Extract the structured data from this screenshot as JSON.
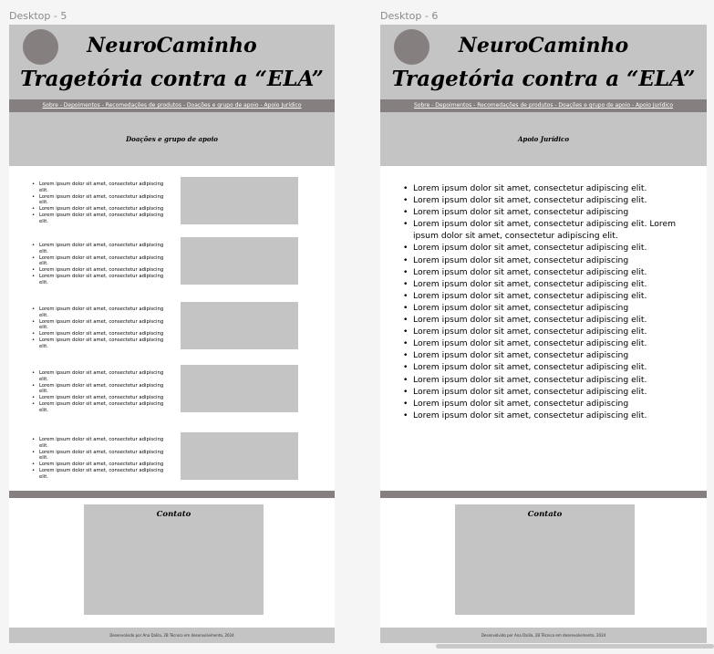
{
  "canvas": {
    "frames": [
      {
        "label": "Desktop - 5",
        "brand_line1": "NeuroCaminho",
        "brand_line2": "Tragetória contra a “ELA”",
        "nav": "Sobre - Depoimentos - Recomedações de produtos - Doações e grupo de apoio - Apoio Jurídico",
        "section_title": "Doações e grupo de apoio",
        "cards": [
          {
            "items": [
              "Lorem ipsum dolor sit amet, consectetur adipiscing elit.",
              "Lorem ipsum dolor sit amet, consectetur adipiscing elit.",
              "Lorem ipsum dolor sit amet, consectetur adipiscing",
              "Lorem ipsum dolor sit amet, consectetur adipiscing elit."
            ]
          },
          {
            "items": [
              "Lorem ipsum dolor sit amet, consectetur adipiscing elit.",
              "Lorem ipsum dolor sit amet, consectetur adipiscing elit.",
              "Lorem ipsum dolor sit amet, consectetur adipiscing",
              "Lorem ipsum dolor sit amet, consectetur adipiscing elit."
            ]
          },
          {
            "items": [
              "Lorem ipsum dolor sit amet, consectetur adipiscing elit.",
              "Lorem ipsum dolor sit amet, consectetur adipiscing elit.",
              "Lorem ipsum dolor sit amet, consectetur adipiscing",
              "Lorem ipsum dolor sit amet, consectetur adipiscing elit."
            ]
          },
          {
            "items": [
              "Lorem ipsum dolor sit amet, consectetur adipiscing elit.",
              "Lorem ipsum dolor sit amet, consectetur adipiscing elit.",
              "Lorem ipsum dolor sit amet, consectetur adipiscing",
              "Lorem ipsum dolor sit amet, consectetur adipiscing elit."
            ]
          },
          {
            "items": [
              "Lorem ipsum dolor sit amet, consectetur adipiscing elit.",
              "Lorem ipsum dolor sit amet, consectetur adipiscing elit.",
              "Lorem ipsum dolor sit amet, consectetur adipiscing",
              "Lorem ipsum dolor sit amet, consectetur adipiscing elit."
            ]
          }
        ],
        "contact_title": "Contato",
        "footer": "Desenvolvido por Ana Dalila, 2B Técnico em desenvolvimento, 2024"
      },
      {
        "label": "Desktop - 6",
        "brand_line1": "NeuroCaminho",
        "brand_line2": "Tragetória contra a “ELA”",
        "nav": "Sobre - Depoimentos - Recomedações de produtos - Doações e grupo de apoio - Apoio Jurídico",
        "section_title": "Apoio Jurídico",
        "items": [
          "Lorem ipsum dolor sit amet, consectetur adipiscing elit.",
          "Lorem ipsum dolor sit amet, consectetur adipiscing elit.",
          "Lorem ipsum dolor sit amet, consectetur adipiscing",
          "Lorem ipsum dolor sit amet, consectetur adipiscing elit. Lorem ipsum dolor sit amet, consectetur adipiscing elit.",
          "Lorem ipsum dolor sit amet, consectetur adipiscing elit.",
          "Lorem ipsum dolor sit amet, consectetur adipiscing",
          "Lorem ipsum dolor sit amet, consectetur adipiscing elit.",
          "Lorem ipsum dolor sit amet, consectetur adipiscing elit.",
          "Lorem ipsum dolor sit amet, consectetur adipiscing elit.",
          "Lorem ipsum dolor sit amet, consectetur adipiscing",
          "Lorem ipsum dolor sit amet, consectetur adipiscing elit.",
          "Lorem ipsum dolor sit amet, consectetur adipiscing elit.",
          "Lorem ipsum dolor sit amet, consectetur adipiscing elit.",
          "Lorem ipsum dolor sit amet, consectetur adipiscing",
          "Lorem ipsum dolor sit amet, consectetur adipiscing elit.",
          "Lorem ipsum dolor sit amet, consectetur adipiscing elit.",
          "Lorem ipsum dolor sit amet, consectetur adipiscing elit.",
          "Lorem ipsum dolor sit amet, consectetur adipiscing",
          "Lorem ipsum dolor sit amet, consectetur adipiscing elit."
        ],
        "contact_title": "Contato",
        "footer": "Desenvolvido por Ana Dalila, 2B Técnico em desenvolvimento, 2024"
      }
    ]
  },
  "colors": {
    "canvas_bg": "#f5f5f5",
    "header_gray": "#c4c4c4",
    "nav_dark": "#857f7f",
    "logo": "#857f7f",
    "frame_bg": "#ffffff"
  }
}
